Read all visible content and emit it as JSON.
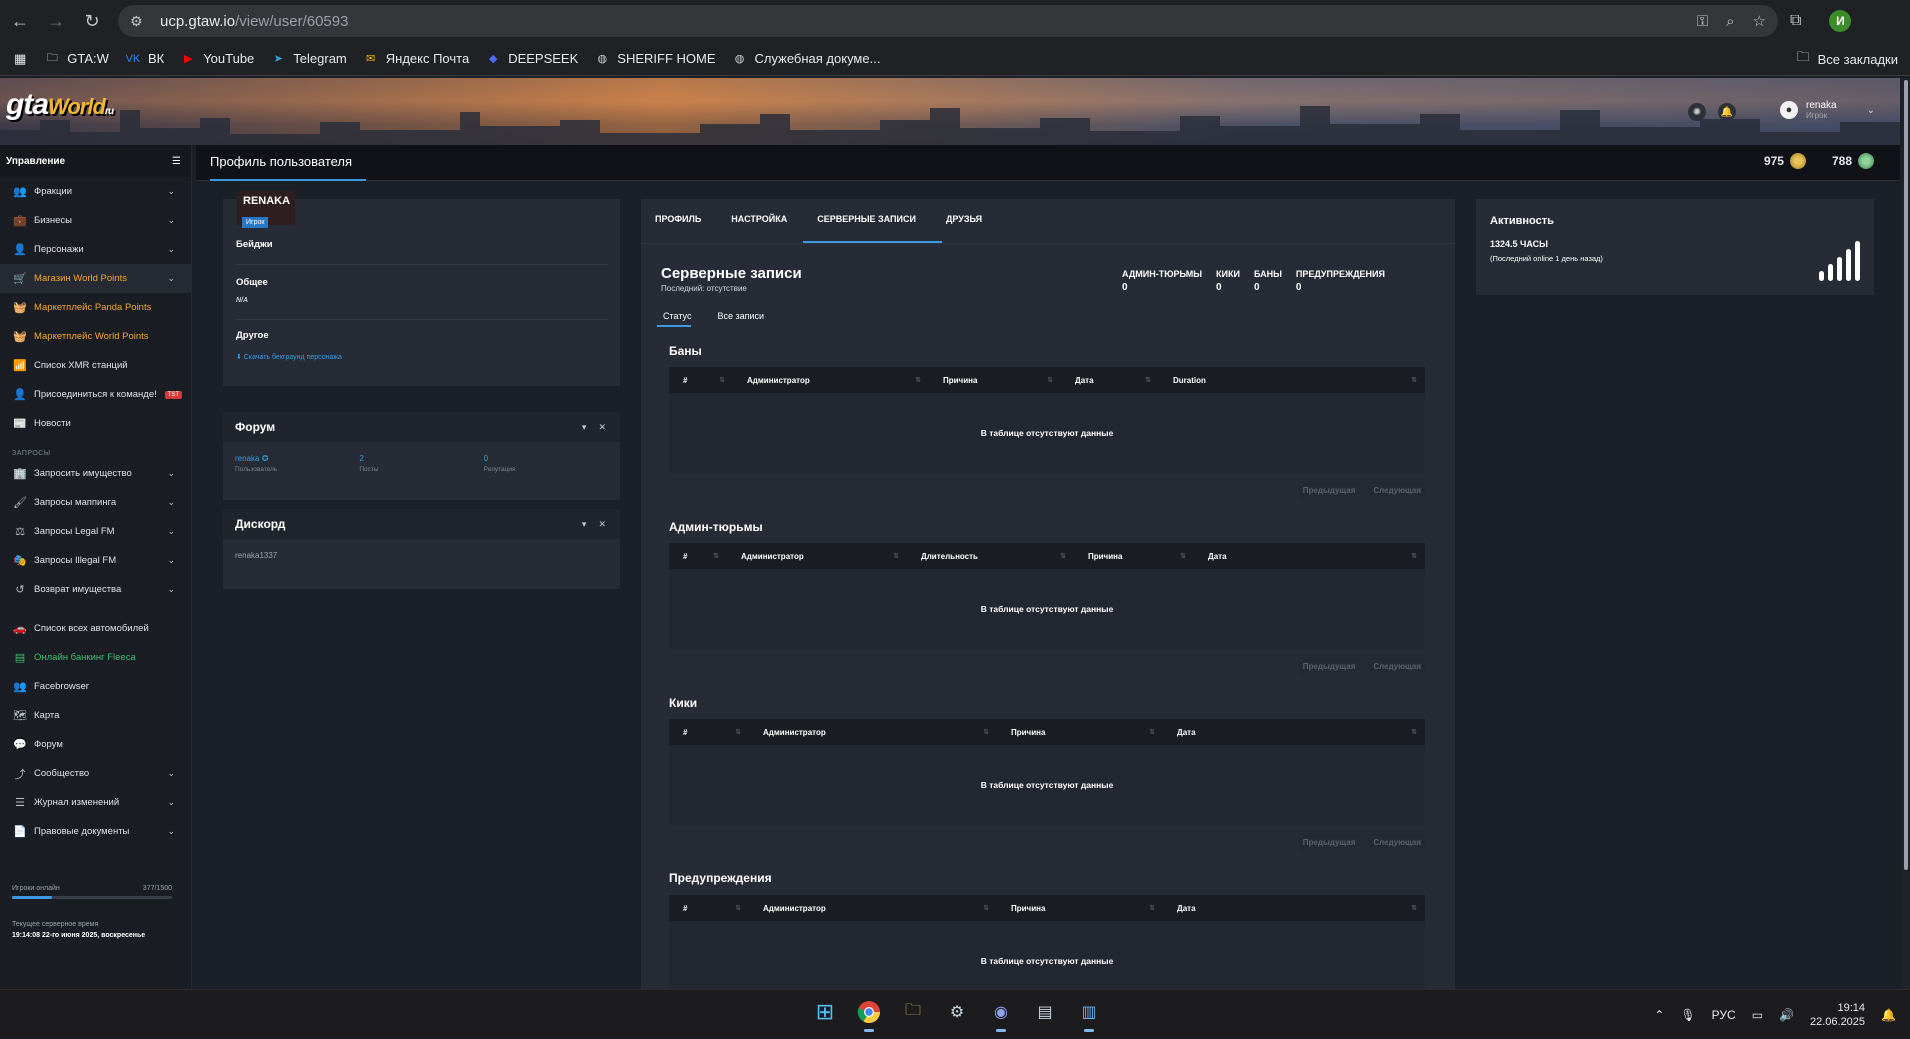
{
  "browser": {
    "url_host": "ucp.gtaw.io",
    "url_path": "/view/user/60593",
    "bookmarks": [
      {
        "label": "GTA:W",
        "icon": "folder-icon",
        "color": "#e8eaed"
      },
      {
        "label": "ВК",
        "icon": "vk-icon",
        "color": "#2787f5"
      },
      {
        "label": "YouTube",
        "icon": "youtube-icon",
        "color": "#ff0000"
      },
      {
        "label": "Telegram",
        "icon": "telegram-icon",
        "color": "#2aa3df"
      },
      {
        "label": "Яндекс Почта",
        "icon": "mail-icon",
        "color": "#f8b400"
      },
      {
        "label": "DEEPSEEK",
        "icon": "deepseek-icon",
        "color": "#4d6bfe"
      },
      {
        "label": "SHERIFF HOME",
        "icon": "globe-icon",
        "color": "#cfcfcf"
      },
      {
        "label": "Служебная докуме...",
        "icon": "globe-icon",
        "color": "#cfcfcf"
      }
    ],
    "all_bookmarks": "Все закладки",
    "profile_initial": "И"
  },
  "banner": {
    "logo_main": "gta",
    "logo_sub": "World",
    "logo_ru": "ru",
    "user_name": "renaka",
    "user_role": "Игрок"
  },
  "sidebar": {
    "header": "Управление",
    "items_top": [
      {
        "label": "Фракции",
        "icon": "users-icon",
        "chevron": true,
        "style": ""
      },
      {
        "label": "Бизнесы",
        "icon": "briefcase-icon",
        "chevron": true,
        "style": ""
      },
      {
        "label": "Персонажи",
        "icon": "user-icon",
        "chevron": true,
        "style": ""
      },
      {
        "label": "Магазин World Points",
        "icon": "cart-icon",
        "chevron": true,
        "style": "active"
      },
      {
        "label": "Маркетплейс Panda Points",
        "icon": "basket-icon",
        "chevron": false,
        "style": "orange"
      },
      {
        "label": "Маркетплейс World Points",
        "icon": "basket-icon",
        "chevron": false,
        "style": "orange"
      },
      {
        "label": "Список XMR станций",
        "icon": "antenna-icon",
        "chevron": false,
        "style": ""
      },
      {
        "label": "Присоединиться к команде!",
        "icon": "user-plus-icon",
        "chevron": false,
        "style": "",
        "tag": "TST"
      },
      {
        "label": "Новости",
        "icon": "newspaper-icon",
        "chevron": false,
        "style": ""
      }
    ],
    "section_requests": "ЗАПРОСЫ",
    "items_requests": [
      {
        "label": "Запросить имущество",
        "icon": "building-icon",
        "chevron": true,
        "style": ""
      },
      {
        "label": "Запросы маппинга",
        "icon": "brush-icon",
        "chevron": true,
        "style": ""
      },
      {
        "label": "Запросы Legal FM",
        "icon": "scale-icon",
        "chevron": true,
        "style": ""
      },
      {
        "label": "Запросы Illegal FM",
        "icon": "mask-icon",
        "chevron": true,
        "style": ""
      },
      {
        "label": "Возврат имущества",
        "icon": "undo-icon",
        "chevron": true,
        "style": ""
      }
    ],
    "items_bottom": [
      {
        "label": "Список всех автомобилей",
        "icon": "car-icon",
        "chevron": false,
        "style": ""
      },
      {
        "label": "Онлайн банкинг Fleeca",
        "icon": "bank-icon",
        "chevron": false,
        "style": "green"
      },
      {
        "label": "Facebrowser",
        "icon": "users-icon",
        "chevron": false,
        "style": ""
      },
      {
        "label": "Карта",
        "icon": "map-icon",
        "chevron": false,
        "style": ""
      },
      {
        "label": "Форум",
        "icon": "forum-icon",
        "chevron": false,
        "style": ""
      },
      {
        "label": "Сообщество",
        "icon": "share-icon",
        "chevron": true,
        "style": ""
      },
      {
        "label": "Журнал изменений",
        "icon": "list-icon",
        "chevron": true,
        "style": ""
      },
      {
        "label": "Правовые документы",
        "icon": "document-icon",
        "chevron": true,
        "style": ""
      }
    ],
    "online_label": "Игроки онлайн",
    "online_value": "377/1500",
    "online_fraction": 0.251,
    "time_label": "Текущее серверное время",
    "time_value": "19:14:08 22-го июня 2025, воскресенье"
  },
  "header": {
    "title": "Профиль пользователя",
    "points_world": "975",
    "points_panda": "788"
  },
  "profile": {
    "name": "RENAKA",
    "role": "Игрок",
    "badges_label": "Бейджи",
    "general_label": "Общее",
    "general_value": "N/A",
    "other_label": "Другое",
    "download_link": "⬇ Скачать бекграунд персонажа"
  },
  "forum": {
    "title": "Форум",
    "user": "renaka",
    "user_label": "Пользователь",
    "posts": "2",
    "posts_label": "Посты",
    "rep": "0",
    "rep_label": "Репутация"
  },
  "discord": {
    "title": "Дискорд",
    "name": "renaka1337"
  },
  "tabs": [
    "ПРОФИЛЬ",
    "НАСТРОЙКА",
    "СЕРВЕРНЫЕ ЗАПИСИ",
    "ДРУЗЬЯ"
  ],
  "records": {
    "title": "Серверные записи",
    "subtitle": "Последний: отсутствие",
    "stats": [
      {
        "label": "АДМИН-ТЮРЬМЫ",
        "value": "0"
      },
      {
        "label": "КИКИ",
        "value": "0"
      },
      {
        "label": "БАНЫ",
        "value": "0"
      },
      {
        "label": "ПРЕДУПРЕЖДЕНИЯ",
        "value": "0"
      }
    ],
    "subtabs": [
      "Статус",
      "Все записи"
    ],
    "empty_text": "В таблице отсутствуют данные",
    "prev": "Предыдущая",
    "next": "Следующая",
    "bans": {
      "title": "Баны",
      "columns": [
        "#",
        "Администратор",
        "Причина",
        "Дата",
        "Duration"
      ]
    },
    "jails": {
      "title": "Админ-тюрьмы",
      "columns": [
        "#",
        "Администратор",
        "Длительность",
        "Причина",
        "Дата"
      ]
    },
    "kicks": {
      "title": "Кики",
      "columns": [
        "#",
        "Администратор",
        "Причина",
        "Дата"
      ]
    },
    "warns": {
      "title": "Предупреждения",
      "columns": [
        "#",
        "Администратор",
        "Причина",
        "Дата"
      ]
    }
  },
  "activity": {
    "title": "Активность",
    "hours": "1324.5 ЧАСЫ",
    "last": "(Последний online 1 день назад)"
  },
  "taskbar": {
    "lang": "РУС",
    "time": "19:14",
    "date": "22.06.2025"
  }
}
